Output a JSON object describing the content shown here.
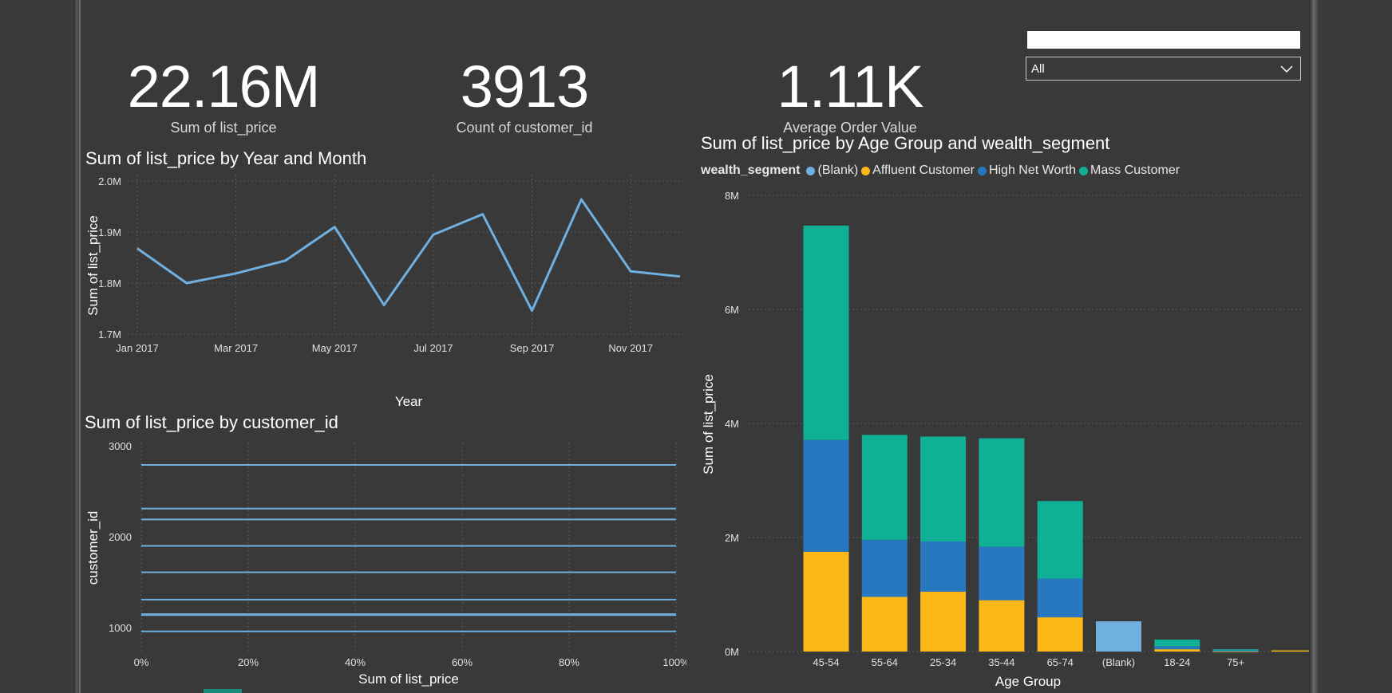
{
  "kpis": [
    {
      "value": "22.16M",
      "label": "Sum of list_price"
    },
    {
      "value": "3913",
      "label": "Count of customer_id"
    },
    {
      "value": "1.11K",
      "label": "Average Order Value"
    }
  ],
  "slicer": {
    "selected": "All"
  },
  "colors": {
    "line": "#6fb0e0",
    "blank": "#6fb0e0",
    "affluent": "#fbb817",
    "high_net_worth": "#2878c0",
    "mass": "#0fb096",
    "grid": "#5a5a5a"
  },
  "line_chart": {
    "title": "Sum of list_price by Year and Month",
    "xlabel": "Year",
    "ylabel": "Sum of list_price",
    "y_ticks": [
      "2.0M",
      "1.9M",
      "1.8M",
      "1.7M"
    ],
    "x_ticks": [
      "Jan 2017",
      "Mar 2017",
      "May 2017",
      "Jul 2017",
      "Sep 2017",
      "Nov 2017"
    ]
  },
  "bar_chart_h": {
    "title": "Sum of list_price by customer_id",
    "xlabel": "Sum of list_price",
    "ylabel": "customer_id",
    "y_ticks": [
      "3000",
      "2000",
      "1000"
    ],
    "x_ticks": [
      "0%",
      "20%",
      "40%",
      "60%",
      "80%",
      "100%"
    ]
  },
  "stack_chart": {
    "title": "Sum of list_price by Age Group and wealth_segment",
    "xlabel": "Age Group",
    "ylabel": "Sum of list_price",
    "legend_title": "wealth_segment",
    "legend": [
      "(Blank)",
      "Affluent Customer",
      "High Net Worth",
      "Mass Customer"
    ],
    "y_ticks": [
      "8M",
      "6M",
      "4M",
      "2M",
      "0M"
    ]
  },
  "chart_data": [
    {
      "type": "line",
      "title": "Sum of list_price by Year and Month",
      "xlabel": "Year",
      "ylabel": "Sum of list_price",
      "x": [
        "Jan 2017",
        "Feb 2017",
        "Mar 2017",
        "Apr 2017",
        "May 2017",
        "Jun 2017",
        "Jul 2017",
        "Aug 2017",
        "Sep 2017",
        "Oct 2017",
        "Nov 2017",
        "Dec 2017"
      ],
      "values": [
        1.868,
        1.8,
        1.819,
        1.844,
        1.91,
        1.757,
        1.895,
        1.935,
        1.746,
        1.964,
        1.823,
        1.813
      ],
      "unit": "M",
      "ylim": [
        1.7,
        2.0
      ]
    },
    {
      "type": "bar",
      "orientation": "horizontal",
      "title": "Sum of list_price by customer_id",
      "xlabel": "Sum of list_price",
      "ylabel": "customer_id",
      "customer_ids": [
        2790,
        2310,
        2190,
        1900,
        1610,
        1310,
        1150,
        1140,
        960
      ],
      "values_pct": [
        100,
        100,
        100,
        100,
        100,
        100,
        100,
        100,
        100
      ],
      "xlim": [
        0,
        100
      ],
      "ylim": [
        800,
        3000
      ]
    },
    {
      "type": "bar",
      "stacked": true,
      "title": "Sum of list_price by Age Group and wealth_segment",
      "xlabel": "Age Group",
      "ylabel": "Sum of list_price",
      "categories": [
        "45-54",
        "55-64",
        "25-34",
        "35-44",
        "65-74",
        "(Blank)",
        "18-24",
        "75+",
        ""
      ],
      "series": [
        {
          "name": "Affluent Customer",
          "values": [
            1.75,
            0.96,
            1.05,
            0.9,
            0.6,
            0,
            0.04,
            0.01,
            0.02
          ]
        },
        {
          "name": "High Net Worth",
          "values": [
            1.96,
            1.0,
            0.88,
            0.94,
            0.68,
            0,
            0.05,
            0.01,
            0
          ]
        },
        {
          "name": "Mass Customer",
          "values": [
            3.76,
            1.84,
            1.84,
            1.9,
            1.36,
            0,
            0.12,
            0.02,
            0
          ]
        },
        {
          "name": "(Blank)",
          "values": [
            0,
            0,
            0,
            0,
            0,
            0.53,
            0,
            0,
            0
          ]
        }
      ],
      "unit": "M",
      "ylim": [
        0,
        8
      ]
    }
  ]
}
